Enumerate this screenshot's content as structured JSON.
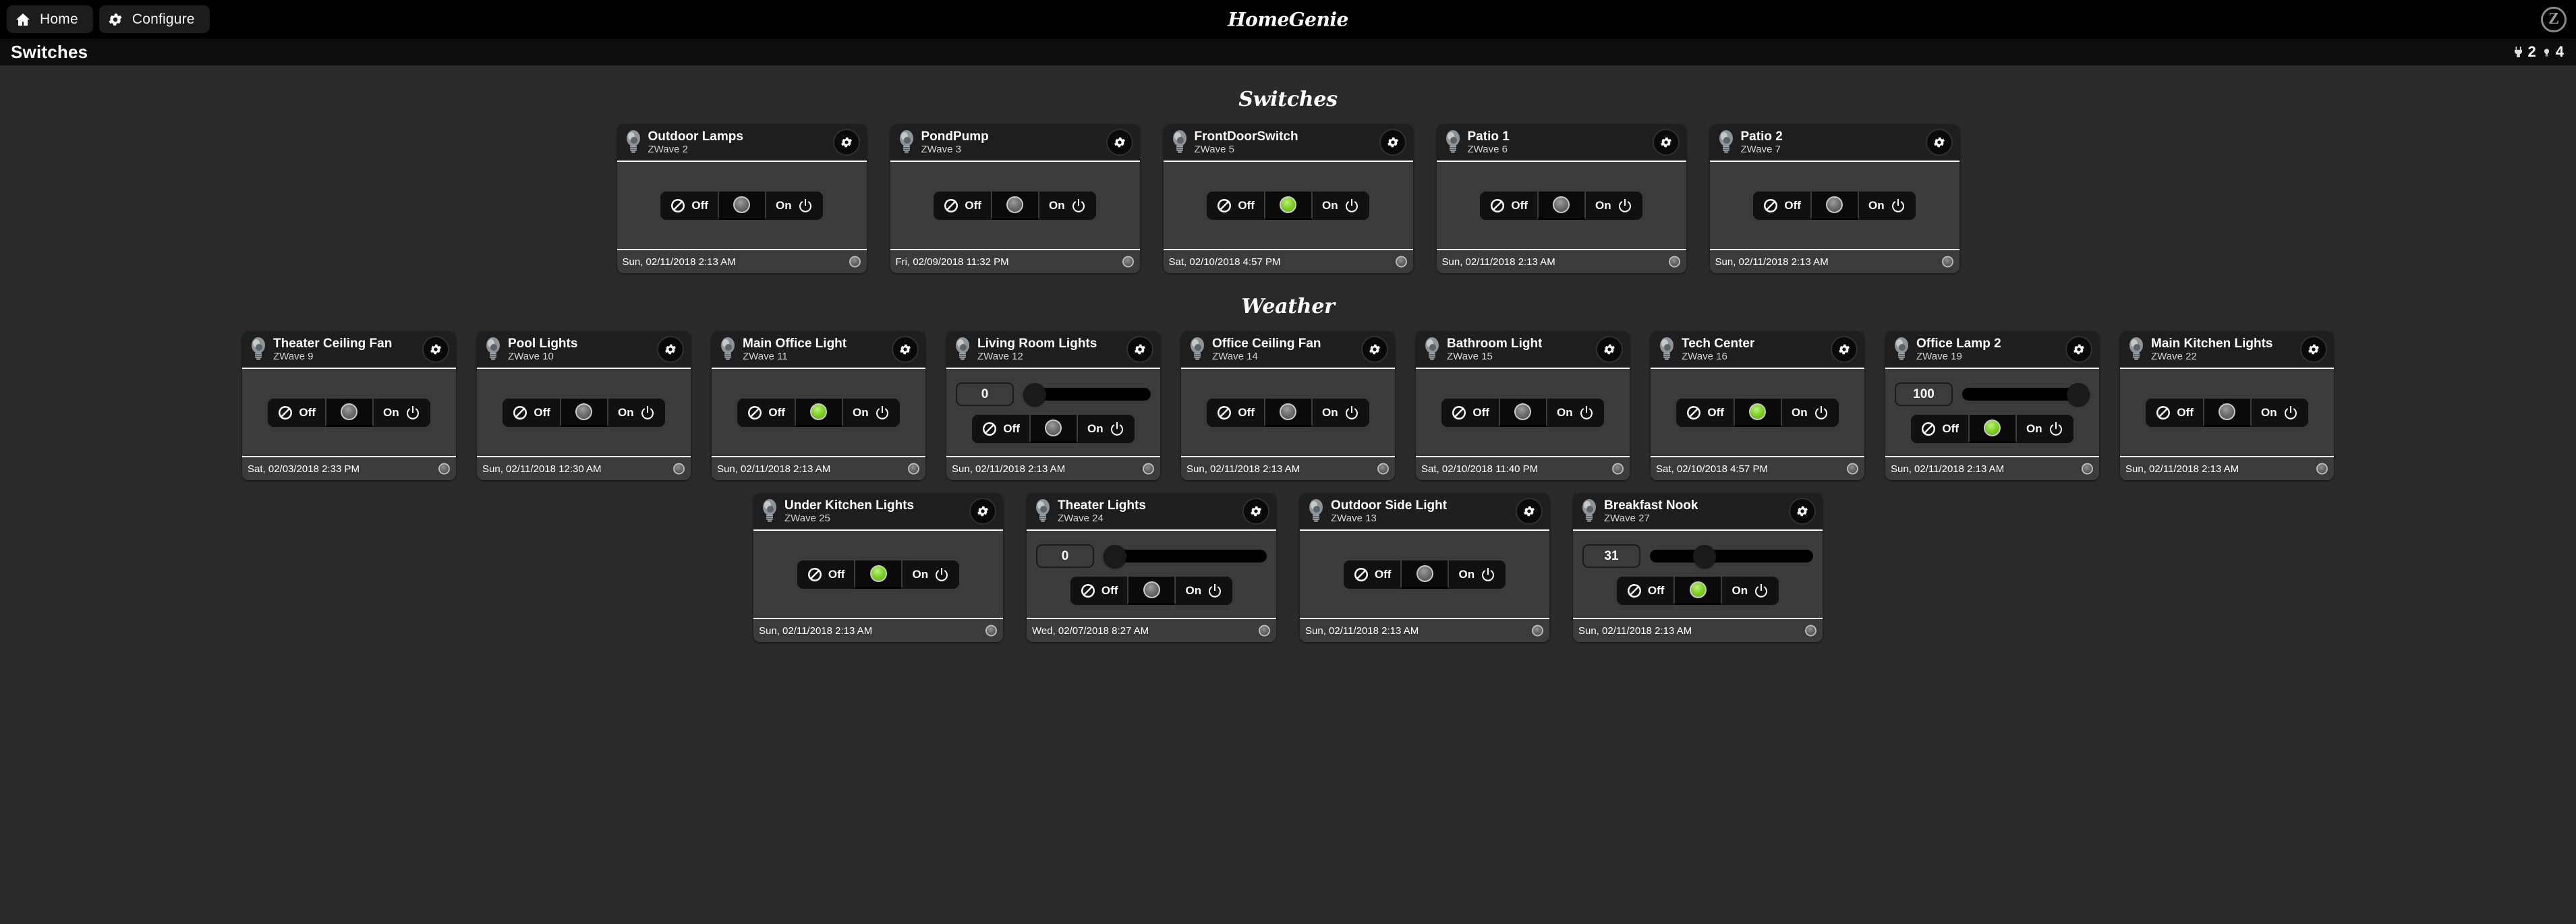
{
  "topbar": {
    "home_label": "Home",
    "configure_label": "Configure",
    "brand": "HomeGenie",
    "zwave_badge": "Z"
  },
  "pagebar": {
    "title": "Switches",
    "stats": [
      {
        "icon": "plug-icon",
        "value": "2"
      },
      {
        "icon": "lightbulb-icon",
        "value": "4"
      }
    ]
  },
  "controls": {
    "off_label": "Off",
    "on_label": "On"
  },
  "sections": [
    {
      "title": "Switches",
      "rows": [
        {
          "width_class": "w-mid",
          "cards": [
            {
              "name": "Outdoor Lamps",
              "sub": "ZWave 2",
              "state": "off",
              "dimmer": false,
              "time": "Sun, 02/11/2018 2:13 AM"
            },
            {
              "name": "PondPump",
              "sub": "ZWave 3",
              "state": "off",
              "dimmer": false,
              "time": "Fri, 02/09/2018 11:32 PM"
            },
            {
              "name": "FrontDoorSwitch",
              "sub": "ZWave 5",
              "state": "on",
              "dimmer": false,
              "time": "Sat, 02/10/2018 4:57 PM"
            },
            {
              "name": "Patio 1",
              "sub": "ZWave 6",
              "state": "off",
              "dimmer": false,
              "time": "Sun, 02/11/2018 2:13 AM"
            },
            {
              "name": "Patio 2",
              "sub": "ZWave 7",
              "state": "off",
              "dimmer": false,
              "time": "Sun, 02/11/2018 2:13 AM"
            }
          ]
        }
      ]
    },
    {
      "title": "Weather",
      "rows": [
        {
          "width_class": "w-narrow",
          "cards": [
            {
              "name": "Theater Ceiling Fan",
              "sub": "ZWave 9",
              "state": "off",
              "dimmer": false,
              "time": "Sat, 02/03/2018 2:33 PM"
            },
            {
              "name": "Pool Lights",
              "sub": "ZWave 10",
              "state": "off",
              "dimmer": false,
              "time": "Sun, 02/11/2018 12:30 AM"
            },
            {
              "name": "Main Office Light",
              "sub": "ZWave 11",
              "state": "on",
              "dimmer": false,
              "time": "Sun, 02/11/2018 2:13 AM"
            },
            {
              "name": "Living Room Lights",
              "sub": "ZWave 12",
              "state": "off",
              "dimmer": true,
              "level": "0",
              "level_pct": 0,
              "time": "Sun, 02/11/2018 2:13 AM"
            },
            {
              "name": "Office Ceiling Fan",
              "sub": "ZWave 14",
              "state": "off",
              "dimmer": false,
              "time": "Sun, 02/11/2018 2:13 AM"
            },
            {
              "name": "Bathroom Light",
              "sub": "ZWave 15",
              "state": "off",
              "dimmer": false,
              "time": "Sat, 02/10/2018 11:40 PM"
            },
            {
              "name": "Tech Center",
              "sub": "ZWave 16",
              "state": "on",
              "dimmer": false,
              "time": "Sat, 02/10/2018 4:57 PM"
            },
            {
              "name": "Office Lamp 2",
              "sub": "ZWave 19",
              "state": "on",
              "dimmer": true,
              "level": "100",
              "level_pct": 100,
              "time": "Sun, 02/11/2018 2:13 AM"
            },
            {
              "name": "Main Kitchen Lights",
              "sub": "ZWave 22",
              "state": "off",
              "dimmer": false,
              "time": "Sun, 02/11/2018 2:13 AM"
            }
          ]
        },
        {
          "width_class": "w-mid",
          "cards": [
            {
              "name": "Under Kitchen Lights",
              "sub": "ZWave 25",
              "state": "on",
              "dimmer": false,
              "time": "Sun, 02/11/2018 2:13 AM"
            },
            {
              "name": "Theater Lights",
              "sub": "ZWave 24",
              "state": "off",
              "dimmer": true,
              "level": "0",
              "level_pct": 0,
              "time": "Wed, 02/07/2018 8:27 AM"
            },
            {
              "name": "Outdoor Side Light",
              "sub": "ZWave 13",
              "state": "off",
              "dimmer": false,
              "time": "Sun, 02/11/2018 2:13 AM"
            },
            {
              "name": "Breakfast Nook",
              "sub": "ZWave 27",
              "state": "on",
              "dimmer": true,
              "level": "31",
              "level_pct": 31,
              "time": "Sun, 02/11/2018 2:13 AM"
            }
          ]
        }
      ]
    }
  ]
}
